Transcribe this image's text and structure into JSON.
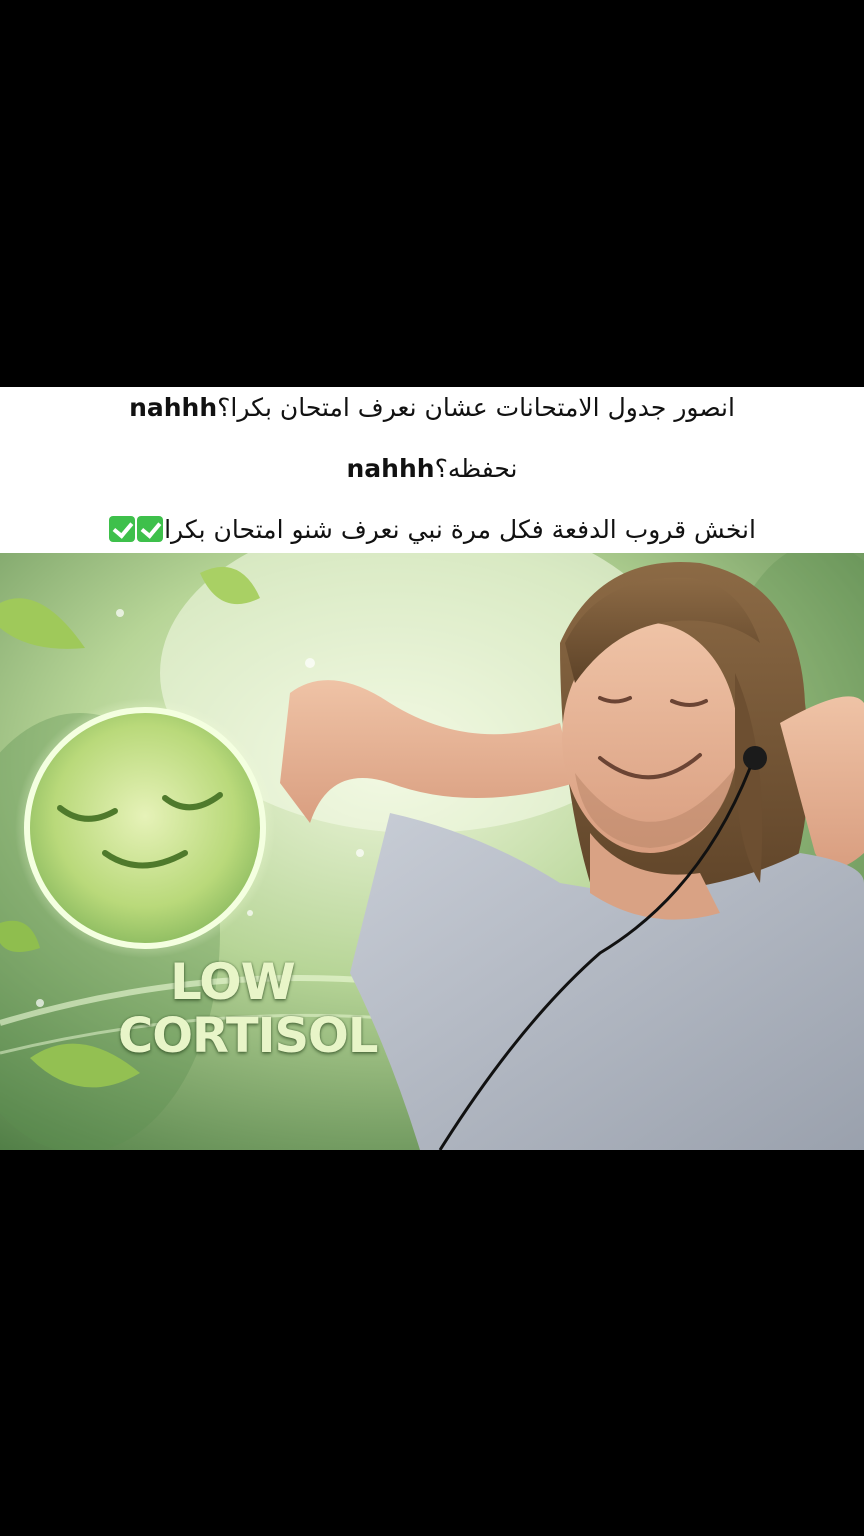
{
  "caption": {
    "line1_arabic": "انصور جدول الامتحانات عشان نعرف امتحان بكرا؟",
    "line1_latin": "nahhh",
    "line2_arabic": "نحفظه؟",
    "line2_latin": "nahhh",
    "line3_arabic": "انخش قروب الدفعة فكل مرة نبي نعرف شنو امتحان بكرا",
    "line3_emoji_count": 2
  },
  "image": {
    "text_top": "LOW",
    "text_bottom": "CORTISOL",
    "icon": "smiling-face-icon",
    "accent": "#b9d97a"
  },
  "colors": {
    "background": "#000000",
    "caption_background": "#ffffff",
    "check_green": "#3ec04b"
  }
}
